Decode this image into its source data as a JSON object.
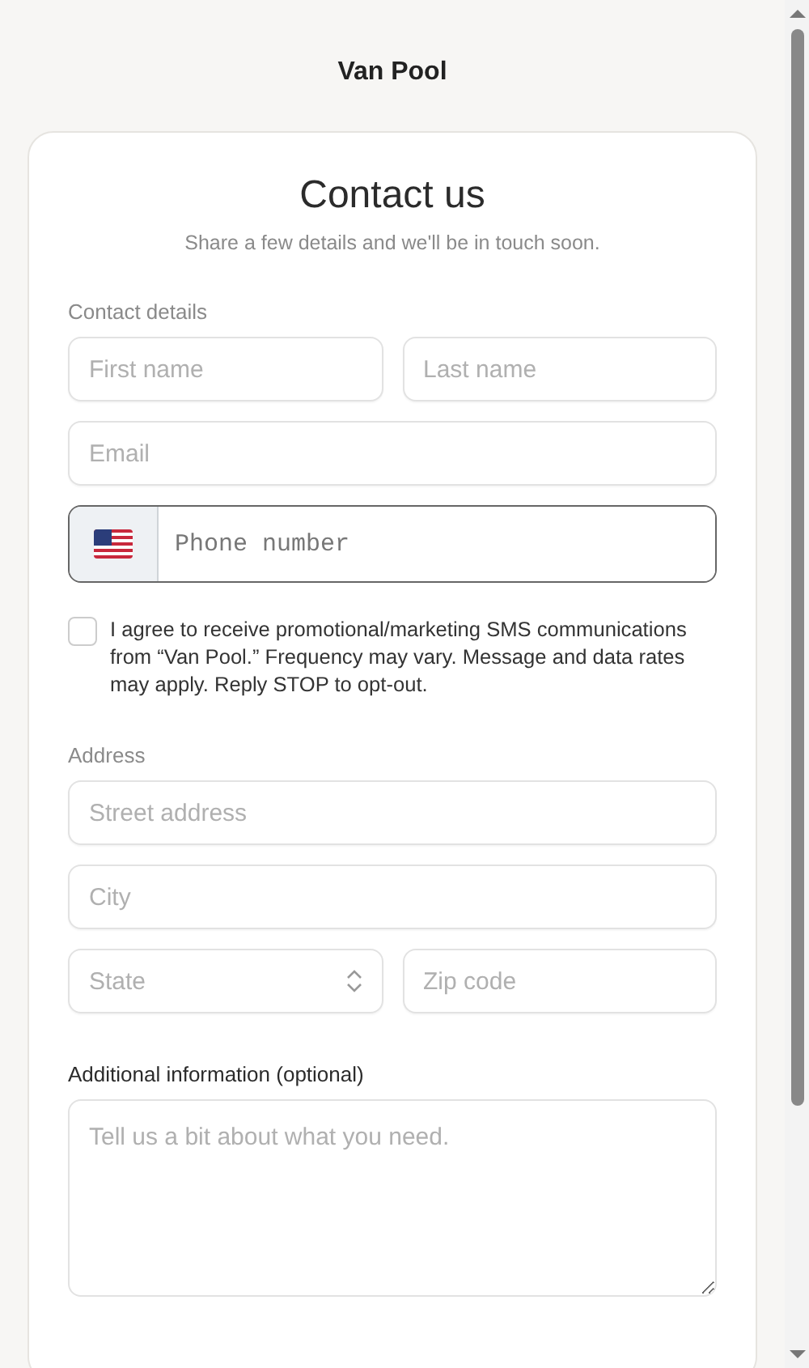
{
  "header": {
    "title": "Van Pool"
  },
  "form": {
    "title": "Contact us",
    "subtitle": "Share a few details and we'll be in touch soon.",
    "sections": [
      {
        "label": "Contact details",
        "kind": "group",
        "rows": [
          [
            {
              "kind": "text",
              "placeholder": "First name"
            },
            {
              "kind": "text",
              "placeholder": "Last name"
            }
          ],
          [
            {
              "kind": "text",
              "placeholder": "Email"
            }
          ],
          [
            {
              "kind": "phone",
              "placeholder": "Phone number"
            }
          ],
          [
            {
              "kind": "checkbox",
              "checked": false,
              "label": "I agree to receive promotional/marketing SMS communications from “Van Pool.” Frequency may vary. Message and data rates may apply. Reply STOP to opt-out."
            }
          ]
        ]
      },
      {
        "label": "Address",
        "kind": "group",
        "rows": [
          [
            {
              "kind": "text",
              "placeholder": "Street address"
            }
          ],
          [
            {
              "kind": "text",
              "placeholder": "City"
            }
          ],
          [
            {
              "kind": "select",
              "placeholder": "State"
            },
            {
              "kind": "text",
              "placeholder": "Zip code"
            }
          ]
        ]
      },
      {
        "label": "Additional information (optional)",
        "kind": "field",
        "rows": [
          [
            {
              "kind": "textarea",
              "placeholder": "Tell us a bit about what you need."
            }
          ]
        ]
      }
    ]
  }
}
